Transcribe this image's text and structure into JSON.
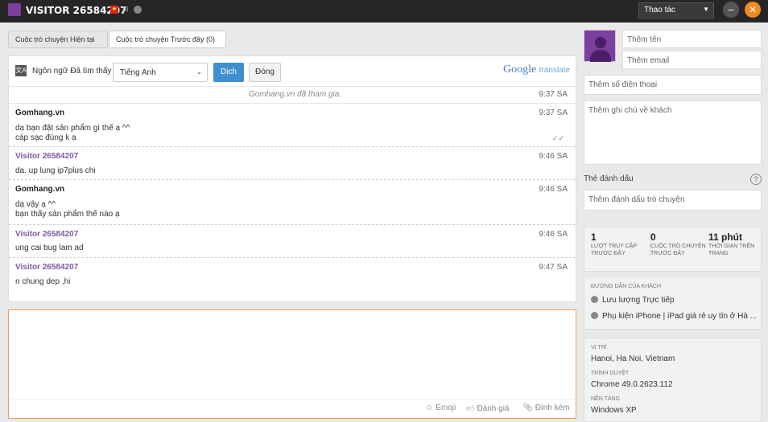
{
  "titlebar": {
    "title": "VISITOR 26584207",
    "action_select": "Thao tác",
    "minimize": "–",
    "close": "✕"
  },
  "tabs": {
    "current": "Cuộc trò chuyện Hiện tại",
    "previous": "Cuộc trò chuyện Trước đây (0)"
  },
  "translate": {
    "label": "Ngôn ngữ Đã tìm thấy",
    "language": "Tiếng Anh",
    "translate_button": "Dịch",
    "close_button": "Đóng",
    "google": "Google",
    "translate_word": "translate"
  },
  "messages": {
    "system": {
      "text": "Gomhang.vn đã tham gia.",
      "time": "9:37 SA"
    },
    "m1": {
      "sender": "Gomhang.vn",
      "time": "9:37 SA",
      "lines": [
        "dạ bạn đặt sản phẩm gì thế ạ ^^",
        "cáp sạc đúng k ạ"
      ]
    },
    "m2": {
      "sender": "Visitor 26584207",
      "time": "9:46 SA",
      "lines": [
        "da. up lung ip7plus chi"
      ]
    },
    "m3": {
      "sender": "Gomhang.vn",
      "time": "9:46 SA",
      "lines": [
        "dạ vậy ạ ^^",
        "bạn thấy sản phẩm thế nào ạ"
      ]
    },
    "m4": {
      "sender": "Visitor 26584207",
      "time": "9:46 SA",
      "lines": [
        "ung cai bug lam ad"
      ]
    },
    "m5": {
      "sender": "Visitor 26584207",
      "time": "9:47 SA",
      "lines": [
        "n chung dep ,hi"
      ]
    }
  },
  "compose": {
    "emoji": "Emoji",
    "rate": "Đánh giá",
    "attach": "Đính kèm"
  },
  "visitor_panel": {
    "name_placeholder": "Thêm tên",
    "email_placeholder": "Thêm email",
    "phone_placeholder": "Thêm số điện thoại",
    "note_placeholder": "Thêm ghi chú về khách",
    "tag_label": "Thẻ đánh dấu",
    "tag_placeholder": "Thêm đánh dấu trò chuyện",
    "help": "?",
    "stats": [
      {
        "num": "1",
        "label": "LƯỢT TRUY CẬP TRƯỚC ĐÂY"
      },
      {
        "num": "0",
        "label": "CUỘC TRÒ CHUYỆN TRƯỚC ĐÂY"
      },
      {
        "num": "11 phút",
        "label": "THỜI GIAN TRÊN TRANG"
      }
    ],
    "path_header": "ĐƯỜNG DẪN CỦA KHÁCH",
    "path_items": [
      "Lưu lượng Trực tiếp",
      "Phụ kiện iPhone | iPad giá rẻ uy tín ở Hà ..."
    ],
    "location_header": "VỊ TRÍ",
    "location": "Hanoi, Ha Noi, Vietnam",
    "browser_header": "TRÌNH DUYỆT",
    "browser": "Chrome 49.0.2623.112",
    "platform_header": "NỀN TẢNG",
    "platform": "Windows XP"
  }
}
